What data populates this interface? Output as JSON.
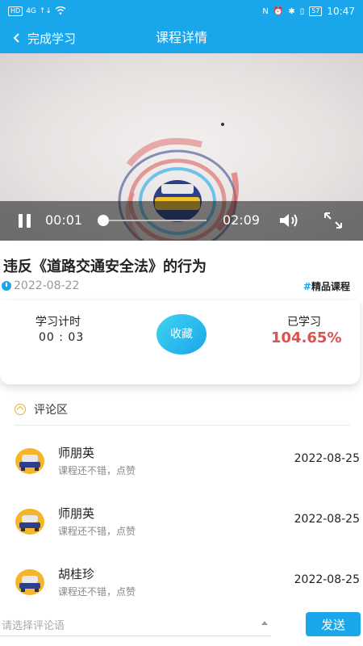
{
  "status_bar": {
    "left_chips": [
      "HD",
      "4G",
      "↑↓",
      "Wi-Fi"
    ],
    "battery": "57",
    "time": "10:47",
    "icons": [
      "nfc-icon",
      "alarm-icon",
      "bluetooth-icon",
      "vibrate-icon",
      "battery-icon"
    ]
  },
  "topbar": {
    "back_label": "完成学习",
    "title": "课程详情"
  },
  "video": {
    "current_time": "00:01",
    "total_time": "02:09",
    "progress": 0.01
  },
  "course": {
    "title": "违反《道路交通安全法》的行为",
    "date": "2022-08-22",
    "tag": "精品课程"
  },
  "stats": {
    "timer_label": "学习计时",
    "timer_value": "00 : 03",
    "favorite_label": "收藏",
    "learned_label": "已学习",
    "learned_value": "104.65%"
  },
  "comments_section": {
    "header": "评论区",
    "items": [
      {
        "name": "师朋英",
        "text": "课程还不错，点赞",
        "date": "2022-08-25"
      },
      {
        "name": "师朋英",
        "text": "课程还不错，点赞",
        "date": "2022-08-25"
      },
      {
        "name": "胡桂珍",
        "text": "课程还不错，点赞",
        "date": "2022-08-25"
      }
    ]
  },
  "composer": {
    "placeholder": "请选择评论语",
    "send_label": "发送"
  },
  "colors": {
    "brand": "#1aa6ea",
    "percent": "#d9534f"
  }
}
